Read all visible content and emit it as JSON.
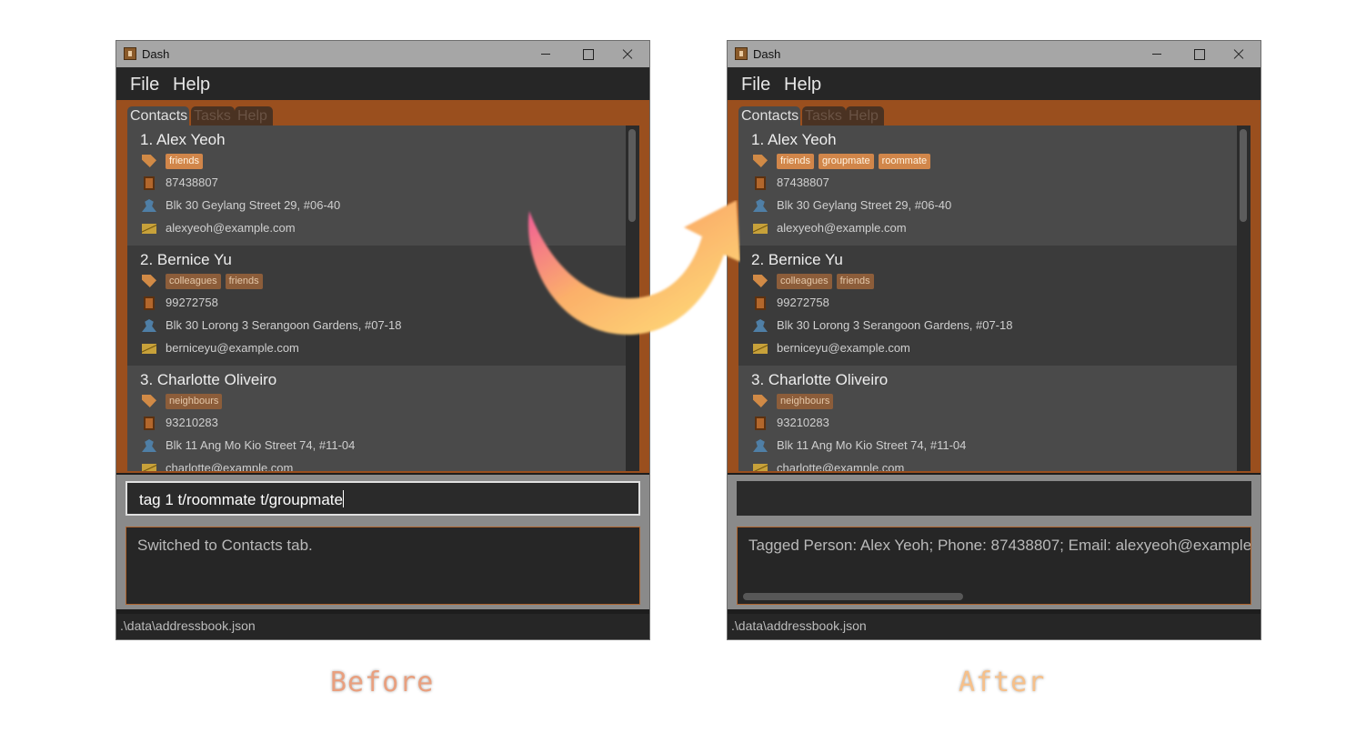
{
  "app": {
    "title": "Dash",
    "menu": [
      "File",
      "Help"
    ],
    "tabs": [
      "Contacts",
      "Tasks",
      "Help"
    ]
  },
  "before": {
    "caption": "Before",
    "contacts": [
      {
        "name": "1.  Alex Yeoh",
        "tags": [
          "friends"
        ],
        "phone": "87438807",
        "address": "Blk 30 Geylang Street 29, #06-40",
        "email": "alexyeoh@example.com"
      },
      {
        "name": "2.  Bernice Yu",
        "tags": [
          "colleagues",
          "friends"
        ],
        "phone": "99272758",
        "address": "Blk 30 Lorong 3 Serangoon Gardens, #07-18",
        "email": "berniceyu@example.com"
      },
      {
        "name": "3.  Charlotte Oliveiro",
        "tags": [
          "neighbours"
        ],
        "phone": "93210283",
        "address": "Blk 11 Ang Mo Kio Street 74, #11-04",
        "email": "charlotte@example.com"
      }
    ],
    "command": "tag 1 t/roommate t/groupmate",
    "result": "Switched to Contacts tab.",
    "status": ".\\data\\addressbook.json"
  },
  "after": {
    "caption": "After",
    "contacts": [
      {
        "name": "1.  Alex Yeoh",
        "tags": [
          "friends",
          "groupmate",
          "roommate"
        ],
        "phone": "87438807",
        "address": "Blk 30 Geylang Street 29, #06-40",
        "email": "alexyeoh@example.com"
      },
      {
        "name": "2.  Bernice Yu",
        "tags": [
          "colleagues",
          "friends"
        ],
        "phone": "99272758",
        "address": "Blk 30 Lorong 3 Serangoon Gardens, #07-18",
        "email": "berniceyu@example.com"
      },
      {
        "name": "3.  Charlotte Oliveiro",
        "tags": [
          "neighbours"
        ],
        "phone": "93210283",
        "address": "Blk 11 Ang Mo Kio Street 74, #11-04",
        "email": "charlotte@example.com"
      }
    ],
    "command": "",
    "result": "Tagged Person: Alex Yeoh; Phone: 87438807; Email: alexyeoh@example",
    "status": ".\\data\\addressbook.json"
  },
  "icons": [
    "app-icon",
    "minimize-icon",
    "maximize-icon",
    "close-icon",
    "tag-icon",
    "phone-icon",
    "address-icon",
    "email-icon",
    "curved-arrow-icon"
  ],
  "colors": {
    "accent": "#9a4f1e",
    "tag": "#d1864a",
    "tag_dim": "#8c5d3a",
    "caption_before": "#e9a07f",
    "caption_after": "#f6c08a"
  }
}
